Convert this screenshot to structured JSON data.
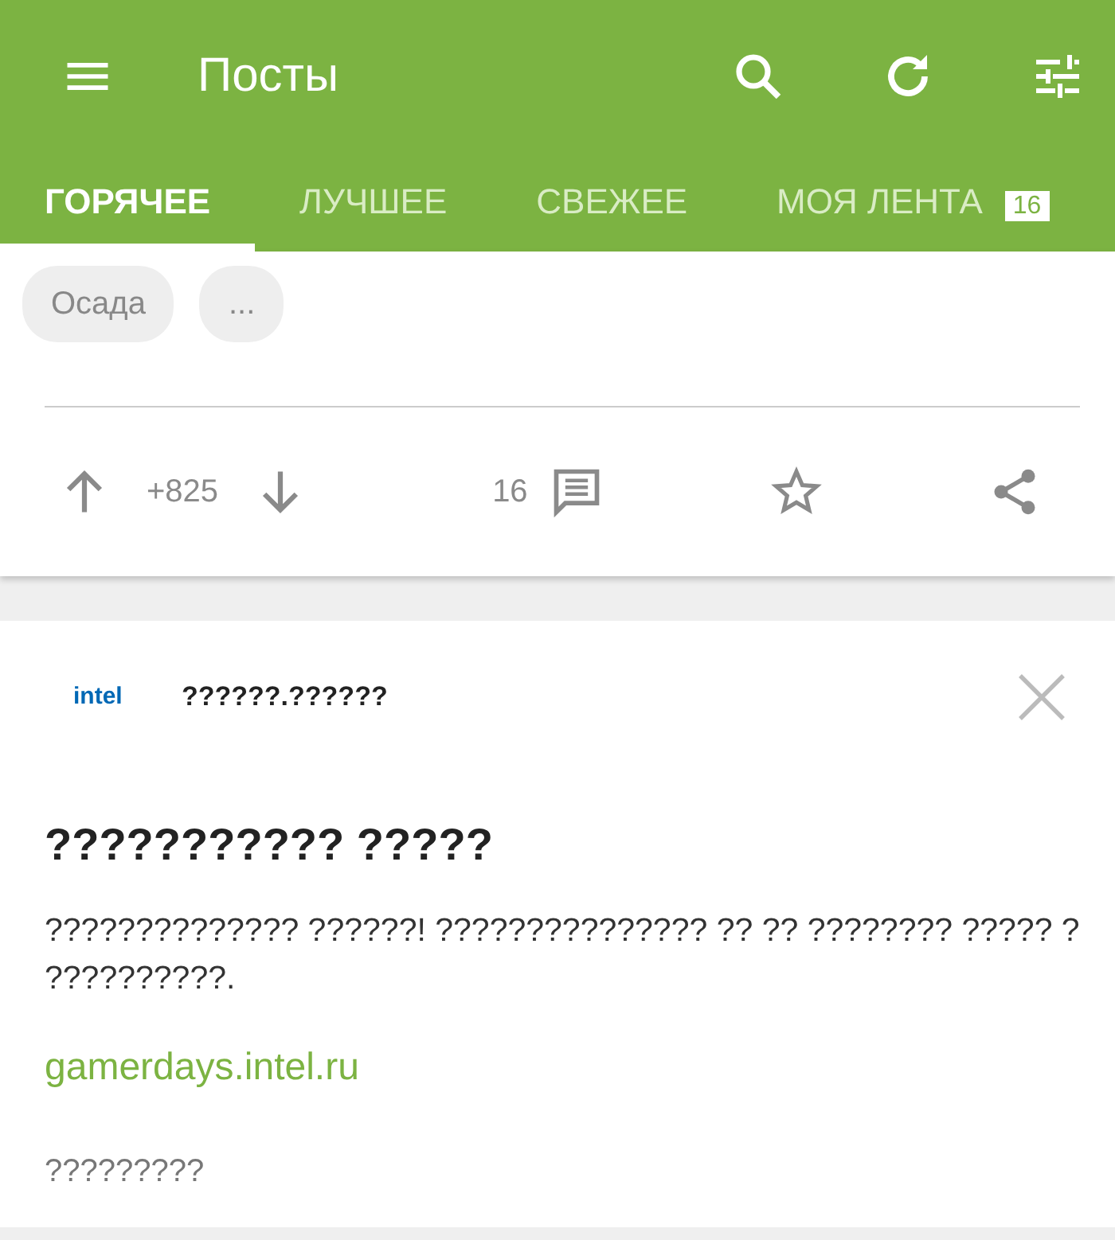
{
  "toolbar": {
    "title": "Посты"
  },
  "tabs": [
    {
      "label": "ГОРЯЧЕЕ",
      "selected": true
    },
    {
      "label": "ЛУЧШЕЕ",
      "selected": false
    },
    {
      "label": "СВЕЖЕЕ",
      "selected": false
    },
    {
      "label": "МОЯ ЛЕНТА",
      "selected": false,
      "count": "16"
    }
  ],
  "post": {
    "tags": [
      "Осада",
      "..."
    ],
    "rating": "+825",
    "comments": "16"
  },
  "ad": {
    "logo": "intel",
    "source": "??????.??????",
    "title": "??????????? ?????",
    "text": "?????????????? ??????! ??????????????? ?? ?? ???????? ????? ? ??????????.",
    "link": "gamerdays.intel.ru",
    "footer": "?????????"
  }
}
